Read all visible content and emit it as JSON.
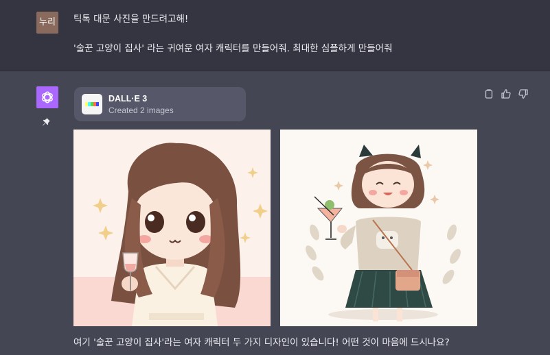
{
  "user": {
    "avatar_text": "누리",
    "line1": "틱톡 대문 사진을 만드려고해!",
    "line2": "'술꾼 고양이 집사' 라는 귀여운 여자 캐릭터를 만들어줘. 최대한 심플하게 만들어줘"
  },
  "assistant": {
    "tool_card": {
      "title": "DALL·E 3",
      "subtitle": "Created 2 images"
    },
    "reply": "여기 '술꾼 고양이 집사'라는 여자 캐릭터 두 가지 디자인이 있습니다! 어떤 것이 마음에 드시나요?"
  },
  "colors": {
    "user_bg": "#343541",
    "assistant_bg": "#444654",
    "gpt_avatar": "#ab68ff",
    "card_bg": "#565869"
  }
}
